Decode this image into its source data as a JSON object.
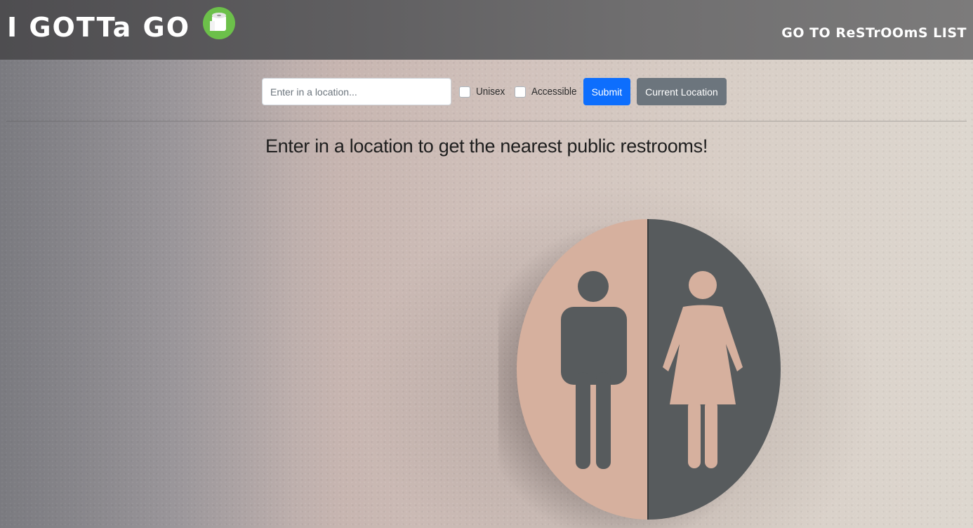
{
  "header": {
    "brand_title": "I GOTTa GO",
    "nav_link": "GO TO ReSTrOOmS LIST"
  },
  "search": {
    "placeholder": "Enter in a location...",
    "value": "",
    "checkbox_unisex": {
      "label": "Unisex",
      "checked": false
    },
    "checkbox_accessible": {
      "label": "Accessible",
      "checked": false
    },
    "submit_label": "Submit",
    "current_location_label": "Current Location"
  },
  "main": {
    "headline": "Enter in a location to get the nearest public restrooms!"
  },
  "colors": {
    "primary": "#0d6efd",
    "secondary": "#6c757d",
    "logo_green": "#6cc04a"
  },
  "icons": {
    "brand_logo": "toilet-paper-icon",
    "background_art": "restroom-sign"
  }
}
